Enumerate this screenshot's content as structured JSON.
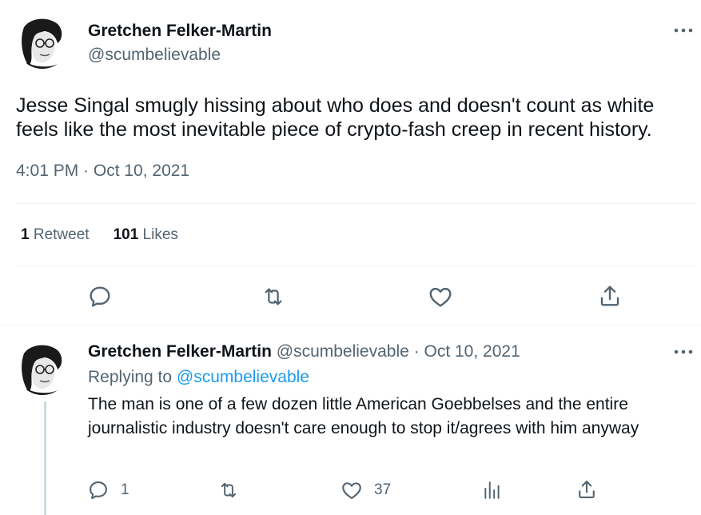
{
  "tweet": {
    "author_name": "Gretchen Felker-Martin",
    "author_handle": "@scumbelievable",
    "text": "Jesse Singal smugly hissing about who does and doesn't count as white feels like the most inevitable piece of crypto-fash creep in recent history.",
    "timestamp": "4:01 PM · Oct 10, 2021",
    "retweets_count": "1",
    "retweets_label": "Retweet",
    "likes_count": "101",
    "likes_label": "Likes",
    "actions": {
      "reply_icon": "reply-icon",
      "retweet_icon": "retweet-icon",
      "like_icon": "heart-icon",
      "share_icon": "share-icon"
    }
  },
  "reply": {
    "author_name": "Gretchen Felker-Martin",
    "author_handle": "@scumbelievable",
    "separator": "·",
    "date": "Oct 10, 2021",
    "replying_prefix": "Replying to",
    "replying_mention": "@scumbelievable",
    "text": "The man is one of a few dozen little American Goebbelses and the entire journalistic industry doesn't care enough to stop it/agrees with him anyway",
    "reply_count": "1",
    "like_count": "37"
  },
  "colors": {
    "text_primary": "#0f1419",
    "text_secondary": "#536471",
    "link": "#1d9bf0",
    "divider": "#eff3f4"
  }
}
